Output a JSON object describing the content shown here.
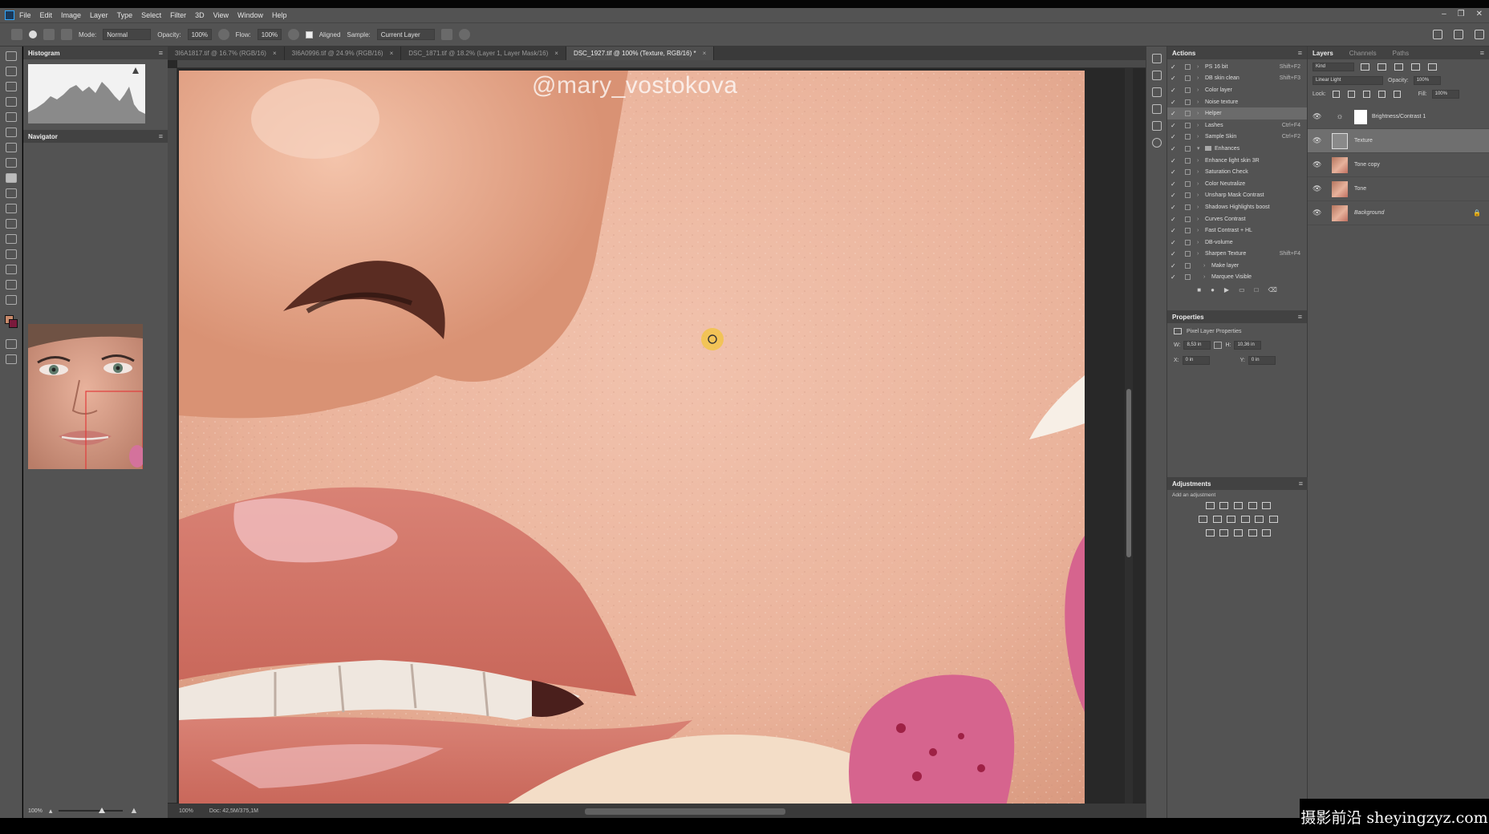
{
  "menu": [
    "File",
    "Edit",
    "Image",
    "Layer",
    "Type",
    "Select",
    "Filter",
    "3D",
    "View",
    "Window",
    "Help"
  ],
  "window_controls": [
    "–",
    "❐",
    "✕"
  ],
  "options": {
    "mode_label": "Mode:",
    "mode_value": "Normal",
    "opacity_label": "Opacity:",
    "opacity_value": "100%",
    "flow_label": "Flow:",
    "flow_value": "100%",
    "aligned_label": "Aligned",
    "sample_label": "Sample:",
    "sample_value": "Current Layer"
  },
  "left_panels": {
    "histogram_title": "Histogram",
    "navigator_title": "Navigator",
    "zoom_value": "100%"
  },
  "doc_tabs": [
    {
      "label": "3I6A1817.tif @ 16.7% (RGB/16)",
      "active": false
    },
    {
      "label": "3I6A0996.tif @ 24.9% (RGB/16)",
      "active": false
    },
    {
      "label": "DSC_1871.tif @ 18.2% (Layer 1, Layer Mask/16)",
      "active": false
    },
    {
      "label": "DSC_1927.tif @ 100% (Texture, RGB/16) *",
      "active": true
    }
  ],
  "canvas": {
    "watermark": "@mary_vostokova"
  },
  "status": {
    "zoom": "100%",
    "doc_size": "Doc: 42,5M/375,1M"
  },
  "actions_panel": {
    "title": "Actions",
    "items": [
      {
        "name": "PS 16 bit",
        "key": "Shift+F2",
        "folder": false,
        "hl": false,
        "indent": 0
      },
      {
        "name": "DB skin clean",
        "key": "Shift+F3",
        "folder": false,
        "hl": false,
        "indent": 0
      },
      {
        "name": "Color layer",
        "key": "",
        "folder": false,
        "hl": false,
        "indent": 0
      },
      {
        "name": "Noise texture",
        "key": "",
        "folder": false,
        "hl": false,
        "indent": 0
      },
      {
        "name": "Helper",
        "key": "",
        "folder": false,
        "hl": true,
        "indent": 0
      },
      {
        "name": "Lashes",
        "key": "Ctrl+F4",
        "folder": false,
        "hl": false,
        "indent": 0
      },
      {
        "name": "Sample Skin",
        "key": "Ctrl+F2",
        "folder": false,
        "hl": false,
        "indent": 0
      },
      {
        "name": "Enhances",
        "key": "",
        "folder": true,
        "hl": false,
        "indent": 0
      },
      {
        "name": "Enhance light skin 3R",
        "key": "",
        "folder": false,
        "hl": false,
        "indent": 0
      },
      {
        "name": "Saturation Check",
        "key": "",
        "folder": false,
        "hl": false,
        "indent": 0
      },
      {
        "name": "Color Neutralize",
        "key": "",
        "folder": false,
        "hl": false,
        "indent": 0
      },
      {
        "name": "Unsharp Mask Contrast",
        "key": "",
        "folder": false,
        "hl": false,
        "indent": 0
      },
      {
        "name": "Shadows Highlights boost",
        "key": "",
        "folder": false,
        "hl": false,
        "indent": 0
      },
      {
        "name": "Curves Contrast",
        "key": "",
        "folder": false,
        "hl": false,
        "indent": 0
      },
      {
        "name": "Fast Contrast + HL",
        "key": "",
        "folder": false,
        "hl": false,
        "indent": 0
      },
      {
        "name": "DB-volume",
        "key": "",
        "folder": false,
        "hl": false,
        "indent": 0
      },
      {
        "name": "Sharpen Texture",
        "key": "Shift+F4",
        "folder": false,
        "hl": false,
        "indent": 0
      },
      {
        "name": "Make layer",
        "key": "",
        "folder": false,
        "hl": false,
        "indent": 1
      },
      {
        "name": "Marquee Visible",
        "key": "",
        "folder": false,
        "hl": false,
        "indent": 1
      }
    ]
  },
  "properties_panel": {
    "title": "Properties",
    "subtitle": "Pixel Layer Properties",
    "w_label": "W:",
    "w_value": "8,53 in",
    "h_label": "H:",
    "h_value": "10,36 in",
    "x_label": "X:",
    "x_value": "0 in",
    "y_label": "Y:",
    "y_value": "0 in"
  },
  "adjustments_panel": {
    "title": "Adjustments",
    "hint": "Add an adjustment"
  },
  "layers_panel": {
    "tabs": [
      "Layers",
      "Channels",
      "Paths"
    ],
    "kind_label": "Kind",
    "blend_mode": "Linear Light",
    "opacity_label": "Opacity:",
    "opacity_value": "100%",
    "lock_label": "Lock:",
    "fill_label": "Fill:",
    "fill_value": "100%",
    "layers": [
      {
        "name": "Brightness/Contrast 1",
        "type": "adjustment",
        "selected": false,
        "locked": false
      },
      {
        "name": "Texture",
        "type": "gray",
        "selected": true,
        "locked": false
      },
      {
        "name": "Tone copy",
        "type": "face",
        "selected": false,
        "locked": false
      },
      {
        "name": "Tone",
        "type": "face",
        "selected": false,
        "locked": false
      },
      {
        "name": "Background",
        "type": "face",
        "selected": false,
        "locked": true
      }
    ]
  },
  "brand_overlay": "摄影前沿 sheyingzyz.com"
}
